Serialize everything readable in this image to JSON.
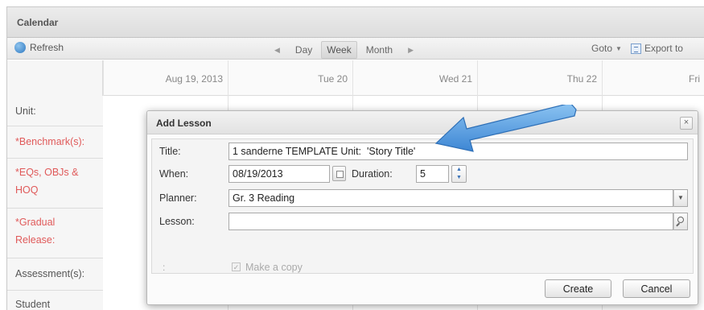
{
  "app": {
    "title": "Calendar"
  },
  "toolbar": {
    "refresh_label": "Refresh",
    "views": [
      "Day",
      "Week",
      "Month"
    ],
    "active_view": "Week",
    "goto_label": "Goto",
    "export_label": "Export to"
  },
  "grid": {
    "day_headers": [
      "Aug 19, 2013",
      "Tue 20",
      "Wed 21",
      "Thu 22",
      "Fri"
    ],
    "row_labels": [
      {
        "text": "Unit:",
        "color": "#555555"
      },
      {
        "text": "*Benchmark(s):",
        "color": "#e05a5a"
      },
      {
        "text": "*EQs, OBJs & HOQ",
        "color": "#e05a5a"
      },
      {
        "text": "*Gradual Release:",
        "color": "#e05a5a"
      },
      {
        "text": "Assessment(s):",
        "color": "#555555"
      },
      {
        "text": "Student",
        "color": "#555555"
      }
    ]
  },
  "dialog": {
    "title": "Add Lesson",
    "close_glyph": "×",
    "fields": {
      "title_label": "Title:",
      "title_value": "1 sanderne TEMPLATE Unit:  'Story Title'",
      "when_label": "When:",
      "when_value": "08/19/2013",
      "duration_label": "Duration:",
      "duration_value": "5",
      "planner_label": "Planner:",
      "planner_value": "Gr. 3 Reading",
      "lesson_label": "Lesson:",
      "lesson_value": ""
    },
    "copy": {
      "colon": ":",
      "label": "Make a copy",
      "checked": true
    },
    "buttons": {
      "create": "Create",
      "cancel": "Cancel"
    }
  },
  "colors": {
    "accent_blue": "#4a8fd6",
    "required_red": "#e05a5a"
  }
}
